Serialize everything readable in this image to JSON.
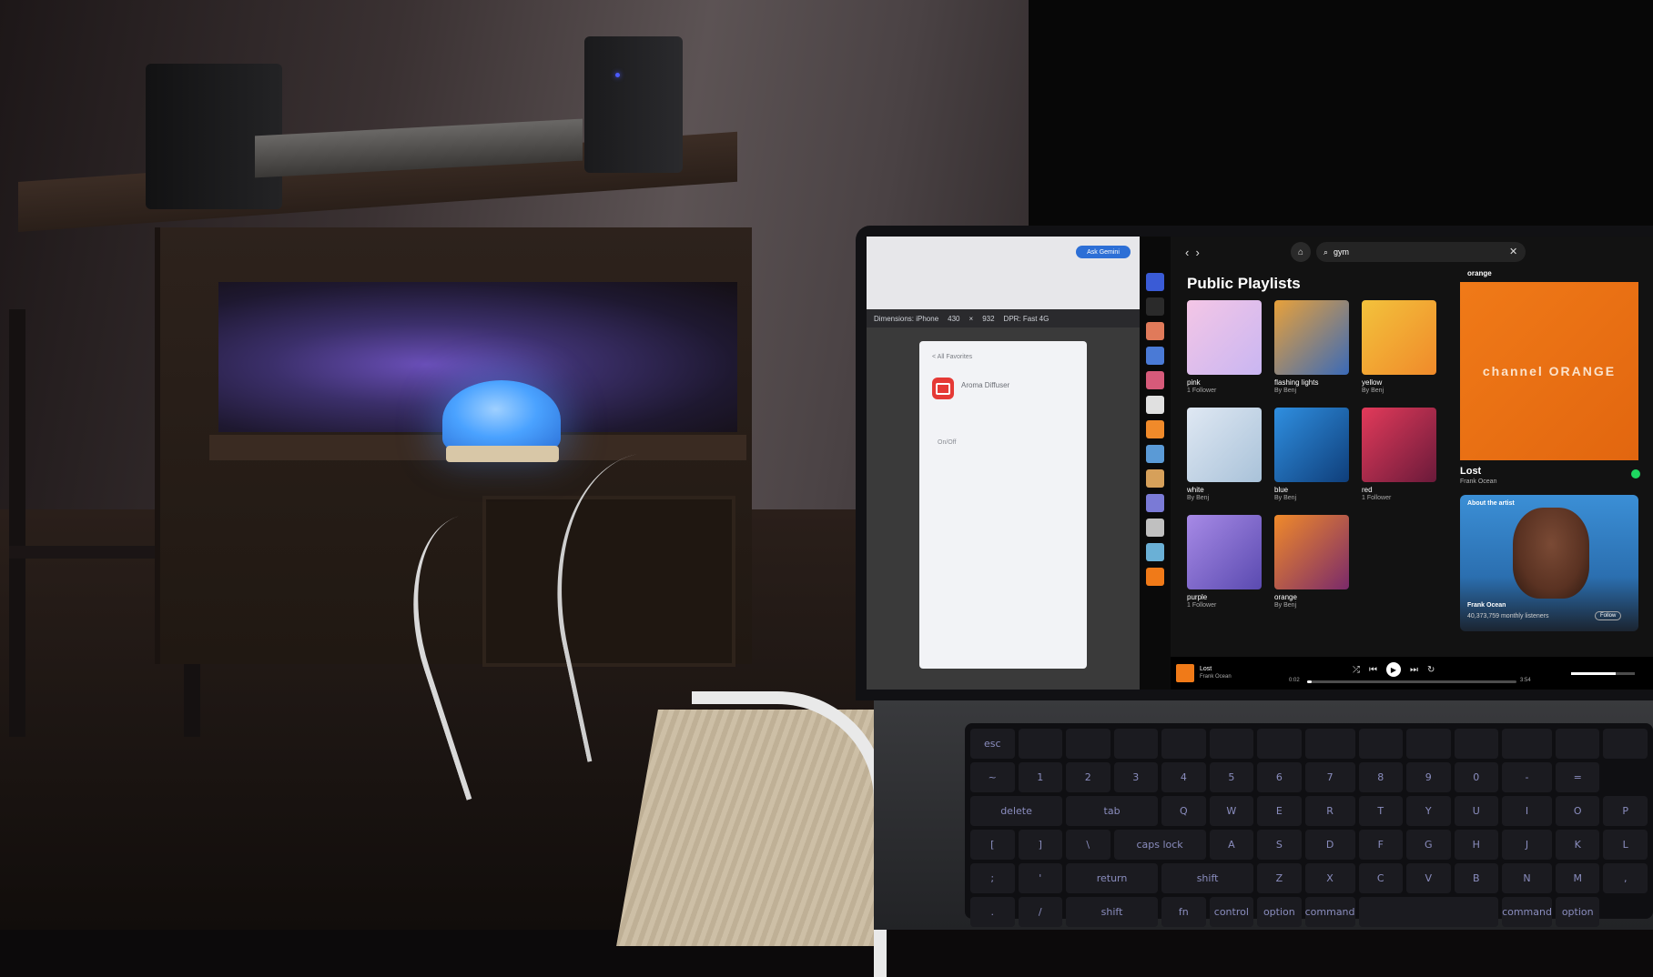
{
  "browser": {
    "ask_button": "Ask Gemini",
    "device_toolbar": [
      "Dimensions: iPhone",
      "430",
      "×",
      "932",
      "DPR: Fast 4G"
    ],
    "phone_screen": {
      "back_link": "< All Favorites",
      "app_title": "Aroma Diffuser",
      "on_label": "On/Off"
    }
  },
  "spotify": {
    "search_query": "gym",
    "section_title": "Public Playlists",
    "playlists": [
      {
        "name": "pink",
        "sub": "1 Follower",
        "colors": [
          "#f4c6e6",
          "#c9b6f2"
        ]
      },
      {
        "name": "flashing lights",
        "sub": "By Benj",
        "colors": [
          "#e8a13a",
          "#3a6ab8"
        ]
      },
      {
        "name": "yellow",
        "sub": "By Benj",
        "colors": [
          "#f3c23c",
          "#f08a2a"
        ]
      },
      {
        "name": "white",
        "sub": "By Benj",
        "colors": [
          "#dfe8f3",
          "#a9c2d9"
        ]
      },
      {
        "name": "blue",
        "sub": "By Benj",
        "colors": [
          "#2f8fe0",
          "#0f3e7a"
        ]
      },
      {
        "name": "red",
        "sub": "1 Follower",
        "colors": [
          "#e23a5a",
          "#6a1a3a"
        ]
      },
      {
        "name": "purple",
        "sub": "1 Follower",
        "colors": [
          "#a78ae6",
          "#5a4ab0"
        ]
      },
      {
        "name": "orange",
        "sub": "By Benj",
        "colors": [
          "#f08a2a",
          "#7a2a6a"
        ]
      }
    ],
    "now_playing": {
      "header": "orange",
      "album_text": "channel ORANGE",
      "title": "Lost",
      "artist": "Frank Ocean",
      "about_label": "About the artist",
      "artist_name": "Frank Ocean",
      "listeners": "40,373,759 monthly listeners",
      "follow": "Follow"
    },
    "player": {
      "title": "Lost",
      "artist": "Frank Ocean",
      "elapsed": "0:02",
      "duration": "3:54",
      "progress": 0.02,
      "volume": 0.7
    }
  },
  "keyboard": {
    "row1": [
      "esc",
      "",
      "",
      "",
      "",
      "",
      "",
      "",
      "",
      "",
      "",
      "",
      "",
      ""
    ],
    "row2": [
      "~",
      "1",
      "2",
      "3",
      "4",
      "5",
      "6",
      "7",
      "8",
      "9",
      "0",
      "-",
      "=",
      "delete"
    ],
    "row3": [
      "tab",
      "Q",
      "W",
      "E",
      "R",
      "T",
      "Y",
      "U",
      "I",
      "O",
      "P",
      "[",
      "]",
      "\\"
    ],
    "row4": [
      "caps lock",
      "A",
      "S",
      "D",
      "F",
      "G",
      "H",
      "J",
      "K",
      "L",
      ";",
      "'",
      "return"
    ],
    "row5": [
      "shift",
      "Z",
      "X",
      "C",
      "V",
      "B",
      "N",
      "M",
      ",",
      ".",
      "/",
      "shift"
    ],
    "row6": [
      "fn",
      "control",
      "option",
      "command",
      "",
      "command",
      "option"
    ]
  },
  "colors": {
    "spotify_green": "#1ed760",
    "album_orange": "#f07a18",
    "diffuser_blue": "#4aa2ff"
  }
}
